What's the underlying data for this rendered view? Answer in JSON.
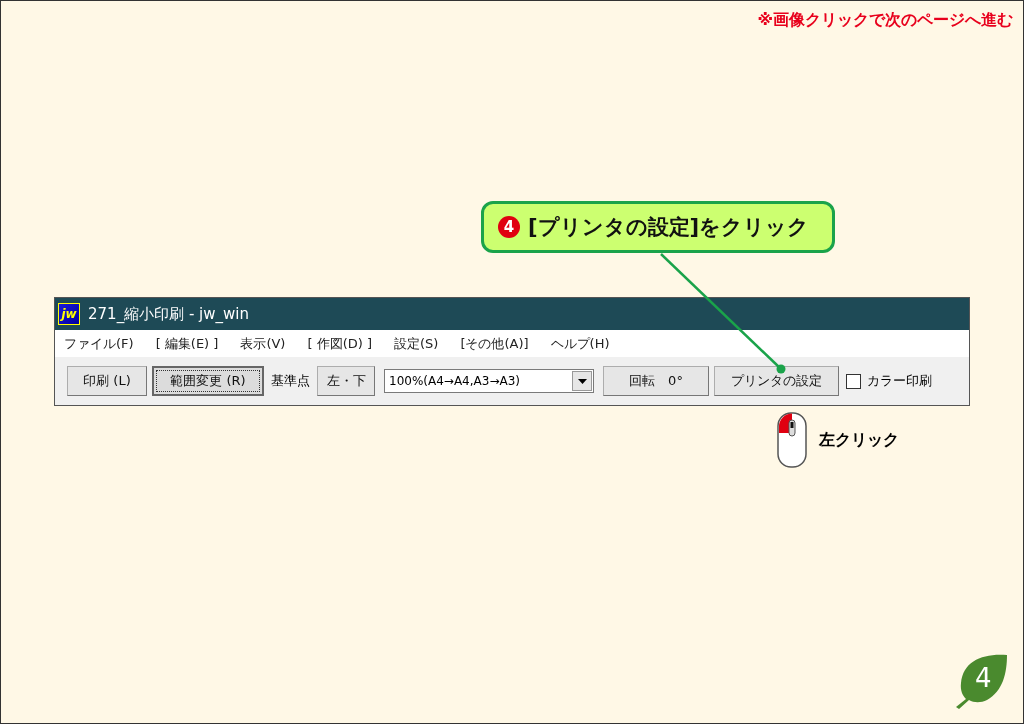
{
  "note": "※画像クリックで次のページへ進む",
  "callout": {
    "step": "4",
    "text": "[プリンタの設定]をクリック"
  },
  "window": {
    "logo": "jw",
    "title": "271_縮小印刷 - jw_win"
  },
  "menu": [
    {
      "label": "ファイル(F)"
    },
    {
      "label": "[ 編集(E) ]"
    },
    {
      "label": "表示(V)"
    },
    {
      "label": "[ 作図(D) ]"
    },
    {
      "label": "設定(S)"
    },
    {
      "label": "[その他(A)]"
    },
    {
      "label": "ヘルプ(H)"
    }
  ],
  "toolbar": [
    {
      "kind": "button",
      "label": "印刷 (L)",
      "pressed": false
    },
    {
      "kind": "button",
      "label": "範囲変更 (R)",
      "pressed": true
    },
    {
      "kind": "label",
      "label": "基準点"
    },
    {
      "kind": "button",
      "label": "左・下",
      "pressed": false
    },
    {
      "kind": "dropdown",
      "value": "100%(A4→A4,A3→A3)"
    },
    {
      "kind": "button",
      "label": "回転　0°",
      "pressed": false
    },
    {
      "kind": "button",
      "label": "プリンタの設定",
      "pressed": false
    },
    {
      "kind": "checkbox",
      "label": "カラー印刷",
      "checked": false
    }
  ],
  "mouse": {
    "label": "左クリック"
  },
  "page_number": "4"
}
